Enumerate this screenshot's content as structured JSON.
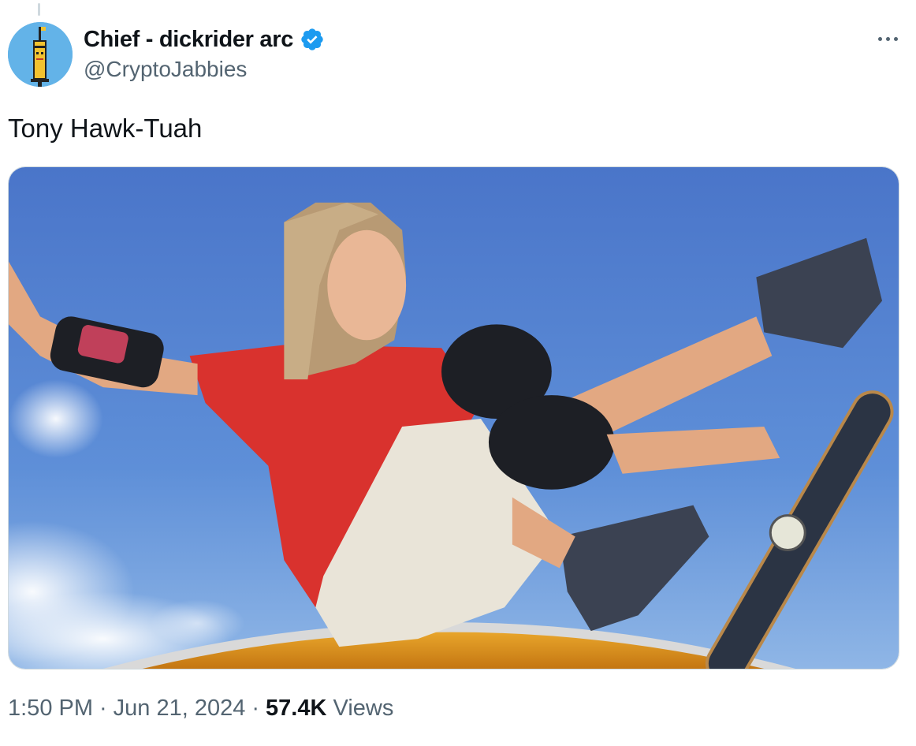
{
  "author": {
    "display_name": "Chief - dickrider arc",
    "handle": "@CryptoJabbies",
    "verified": true,
    "avatar_icon": "pixel-syringe-avatar-icon",
    "avatar_bg": "#63b3e8"
  },
  "tweet": {
    "text": "Tony Hawk-Tuah",
    "media_icon": "skateboarder-photo"
  },
  "meta": {
    "time": "1:50 PM",
    "separator": "·",
    "date": "Jun 21, 2024",
    "views_count": "57.4K",
    "views_label": "Views"
  },
  "colors": {
    "text_primary": "#0f1419",
    "text_secondary": "#536471",
    "verified_blue": "#1d9bf0",
    "border": "#cfd9de"
  },
  "icons": {
    "more": "more-options-icon",
    "verified": "verified-badge-icon"
  }
}
